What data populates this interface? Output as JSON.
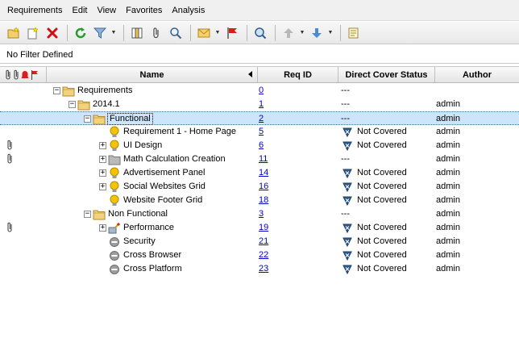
{
  "menu": [
    "Requirements",
    "Edit",
    "View",
    "Favorites",
    "Analysis"
  ],
  "filter": {
    "text": "No Filter Defined"
  },
  "columns": {
    "name": "Name",
    "req_id": "Req ID",
    "status": "Direct Cover Status",
    "author": "Author"
  },
  "colors": {
    "link": "#0000cc",
    "selected_row": "#cde5fb",
    "folder": "#f2d27a",
    "bulb": "#f5c400"
  },
  "rows": [
    {
      "name": "Requirements",
      "id": "0",
      "status": "---",
      "author": "",
      "icon": "folder-icon",
      "indent": 0,
      "expander": "-",
      "attachment": false
    },
    {
      "name": "2014.1",
      "id": "1",
      "status": "---",
      "author": "admin",
      "icon": "folder-icon",
      "indent": 1,
      "expander": "-",
      "attachment": false
    },
    {
      "name": "Functional",
      "id": "2",
      "status": "---",
      "author": "admin",
      "icon": "folder-icon",
      "indent": 2,
      "expander": "-",
      "attachment": false,
      "selected": true
    },
    {
      "name": "Requirement 1 - Home Page",
      "id": "5",
      "status": "Not Covered",
      "author": "admin",
      "icon": "lightbulb-icon",
      "indent": 3,
      "expander": "",
      "attachment": false
    },
    {
      "name": "UI Design",
      "id": "6",
      "status": "Not Covered",
      "author": "admin",
      "icon": "lightbulb-icon",
      "indent": 3,
      "expander": "+",
      "attachment": true
    },
    {
      "name": "Math Calculation Creation",
      "id": "11",
      "status": "---",
      "author": "admin",
      "icon": "folder-gray-icon",
      "indent": 3,
      "expander": "+",
      "attachment": true
    },
    {
      "name": "Advertisement Panel",
      "id": "14",
      "status": "Not Covered",
      "author": "admin",
      "icon": "lightbulb-icon",
      "indent": 3,
      "expander": "+",
      "attachment": false
    },
    {
      "name": "Social Websites Grid",
      "id": "16",
      "status": "Not Covered",
      "author": "admin",
      "icon": "lightbulb-icon",
      "indent": 3,
      "expander": "+",
      "attachment": false
    },
    {
      "name": "Website Footer Grid",
      "id": "18",
      "status": "Not Covered",
      "author": "admin",
      "icon": "lightbulb-icon",
      "indent": 3,
      "expander": "",
      "attachment": false
    },
    {
      "name": "Non Functional",
      "id": "3",
      "status": "---",
      "author": "admin",
      "icon": "folder-icon",
      "indent": 2,
      "expander": "-",
      "attachment": false
    },
    {
      "name": "Performance",
      "id": "19",
      "status": "Not Covered",
      "author": "admin",
      "icon": "performance-icon",
      "indent": 3,
      "expander": "+",
      "attachment": true
    },
    {
      "name": "Security",
      "id": "21",
      "status": "Not Covered",
      "author": "admin",
      "icon": "gray-circle-icon",
      "indent": 3,
      "expander": "",
      "attachment": false
    },
    {
      "name": "Cross Browser",
      "id": "22",
      "status": "Not Covered",
      "author": "admin",
      "icon": "gray-circle-icon",
      "indent": 3,
      "expander": "",
      "attachment": false
    },
    {
      "name": "Cross Platform",
      "id": "23",
      "status": "Not Covered",
      "author": "admin",
      "icon": "gray-circle-icon",
      "indent": 3,
      "expander": "",
      "attachment": false
    }
  ]
}
